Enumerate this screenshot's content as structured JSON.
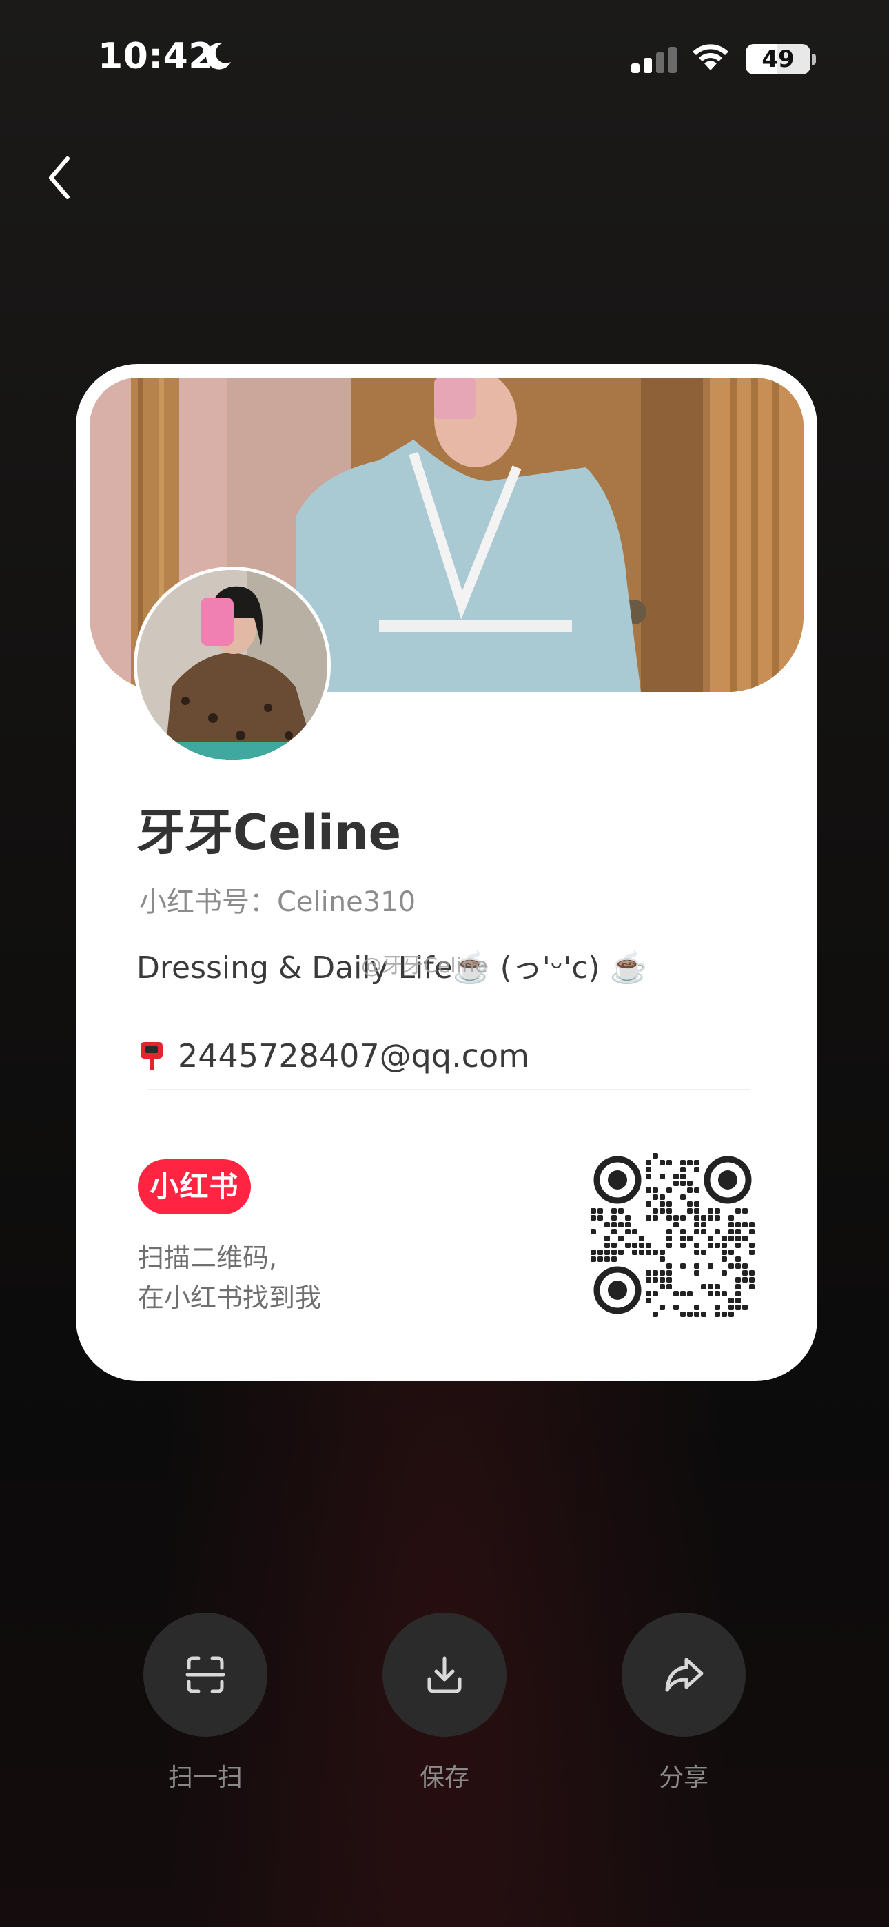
{
  "status_bar": {
    "time": "10:42",
    "battery": "49",
    "battery_percent": 49
  },
  "profile": {
    "nickname": "牙牙Celine",
    "rednote_id": "小红书号：Celine310",
    "bio": "Dressing & Daily Life☕️ (っ'ᵕ'c) ☕️",
    "watermark": "@牙牙Celine",
    "email": "2445728407@qq.com"
  },
  "brand": {
    "logo_text": "小红书",
    "color": "#ff2442"
  },
  "scan_hint": {
    "line1": "扫描二维码,",
    "line2": "在小红书找到我"
  },
  "actions": [
    {
      "label": "扫一扫",
      "icon": "scan-icon"
    },
    {
      "label": "保存",
      "icon": "download-icon"
    },
    {
      "label": "分享",
      "icon": "share-icon"
    }
  ]
}
